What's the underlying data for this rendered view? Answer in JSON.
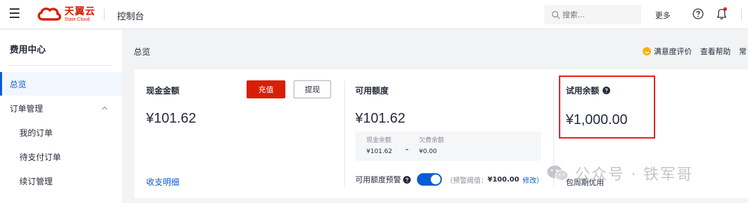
{
  "header": {
    "logo_cn": "天翼云",
    "logo_en": "State Cloud",
    "console": "控制台",
    "search_placeholder": "搜索...",
    "more": "更多",
    "brand_color": "#d81e06"
  },
  "sidebar": {
    "title": "费用中心",
    "items": [
      {
        "label": "总览"
      },
      {
        "label": "订单管理"
      },
      {
        "label": "我的订单"
      },
      {
        "label": "待支付订单"
      },
      {
        "label": "续订管理"
      }
    ]
  },
  "main": {
    "breadcrumb": "总览",
    "links": {
      "satisfaction": "满意度评价",
      "help": "查看帮助",
      "more": "常"
    },
    "cash": {
      "title": "现金金额",
      "amount": "¥101.62",
      "recharge": "充值",
      "withdraw": "提现",
      "details_link": "收支明细"
    },
    "available": {
      "title": "可用额度",
      "amount": "¥101.62",
      "cash_balance_label": "现金余额",
      "cash_balance": "¥101.62",
      "arrears_label": "欠费余额",
      "arrears": "¥0.00",
      "alert_label": "可用额度预警",
      "alert_detail": "（预警阈值：",
      "alert_value": "¥100.00",
      "alert_edit": "修改）",
      "alert_enabled": true
    },
    "trial": {
      "title": "试用余额",
      "amount": "¥1,000.00",
      "bottom": "包周期优用"
    }
  },
  "watermark": "公众号 · 铁军哥",
  "colors": {
    "accent": "#0a5bd6",
    "highlight": "#e8211d"
  }
}
